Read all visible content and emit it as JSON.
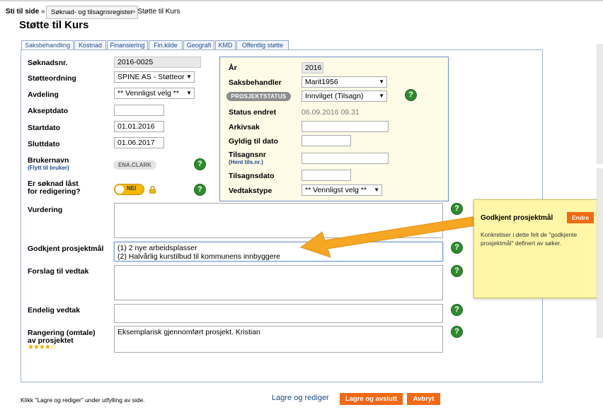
{
  "breadcrumb": {
    "label": "Sti til side",
    "sep1": "»",
    "button": "Søknad- og tilsagnsregister",
    "sep2": "»",
    "current": "Støtte til Kurs"
  },
  "page_title": "Støtte til Kurs",
  "tabs": [
    "Saksbehandling",
    "Kostnad",
    "Finansiering",
    "Fin.kilde",
    "Geografi",
    "KMD",
    "Offentlig støtte"
  ],
  "left": {
    "soknadsnr_label": "Søknadsnr.",
    "soknadsnr_value": "2016-0025",
    "stotteordning_label": "Støtteordning",
    "stotteordning_value": "SPINE AS - Støtteor",
    "avdeling_label": "Avdeling",
    "avdeling_value": "** Vennligst velg **",
    "akseptdato_label": "Akseptdato",
    "akseptdato_value": "",
    "startdato_label": "Startdato",
    "startdato_value": "01.01.2016",
    "sluttdato_label": "Sluttdato",
    "sluttdato_value": "01.06.2017",
    "brukernavn_label": "Brukernavn",
    "brukernavn_sub": "(Flytt til bruker)",
    "brukernavn_value": "ENA.CLARK",
    "locked_label1": "Er søknad låst",
    "locked_label2": "for redigering?",
    "locked_toggle": "NEI"
  },
  "right": {
    "ar_label": "År",
    "ar_value": "2016",
    "saksbehandler_label": "Saksbehandler",
    "saksbehandler_value": "Marit1956",
    "prosjektstatus_label": "PROSJEKTSTATUS",
    "prosjektstatus_value": "Innvilget (Tilsagn)",
    "status_endret_label": "Status endret",
    "status_endret_value": "06.09.2016 09.31",
    "arkivsak_label": "Arkivsak",
    "gyldig_label": "Gyldig til dato",
    "tilsagnsnr_label": "Tilsagnsnr",
    "tilsagnsnr_sub": "(Hent tils.nr.)",
    "tilsagnsdato_label": "Tilsagnsdato",
    "vedtakstype_label": "Vedtakstype",
    "vedtakstype_value": "** Vennligst velg **"
  },
  "text_fields": {
    "vurdering_label": "Vurdering",
    "vurdering_value": "",
    "godkjent_label": "Godkjent prosjektmål",
    "godkjent_line1": "(1) 2 nye arbeidsplasser",
    "godkjent_line2": "(2) Halvårlig kurstilbud til kommunens innbyggere",
    "forslag_label": "Forslag til vedtak",
    "endelig_label": "Endelig vedtak",
    "rangering_label1": "Rangering (omtale)",
    "rangering_label2": "av prosjektet",
    "rangering_stars": "★★★★☆",
    "rangering_rating": 4,
    "rangering_value": "Eksemplarisk gjennomført prosjekt. Kristian"
  },
  "tooltip": {
    "title": "Godkjent prosjektmål",
    "button": "Endre",
    "body": "Konkretiser i dette felt de \"godkjente prosjektmål\" definert av søker."
  },
  "footer": {
    "note": "Klikk \"Lagre og rediger\" under utfylling av side.",
    "save_edit": "Lagre og rediger",
    "save_close": "Lagre og avslutt",
    "cancel": "Avbryt"
  },
  "colors": {
    "accent_orange": "#f26a13",
    "help_green": "#2e8b2e",
    "arrow": "#f5a623",
    "tooltip_bg": "#fff6a8",
    "info_box_bg": "#fefbe6"
  }
}
